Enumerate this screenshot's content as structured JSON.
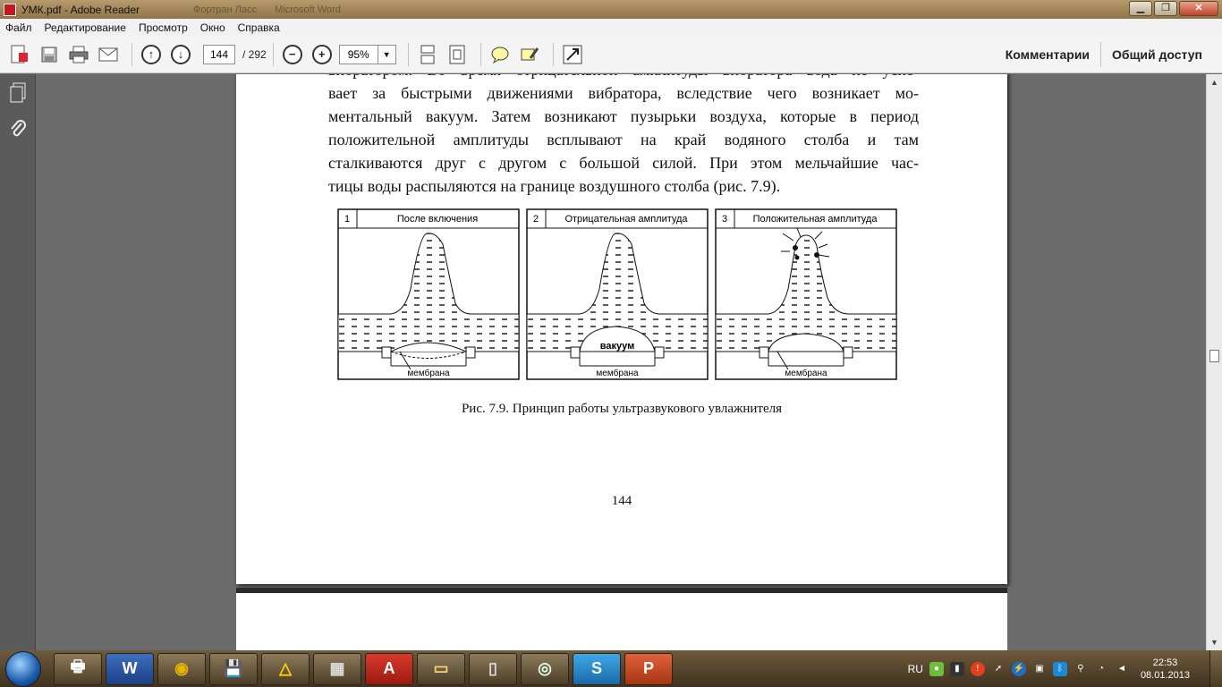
{
  "window": {
    "title": "УМК.pdf - Adobe Reader",
    "ghost_tabs": [
      "Фортран Ласс",
      "Microsoft Word"
    ],
    "buttons": {
      "minimize": "▁",
      "maximize": "❐",
      "close": "✕"
    }
  },
  "menu": [
    "Файл",
    "Редактирование",
    "Просмотр",
    "Окно",
    "Справка"
  ],
  "toolbar": {
    "page_current": "144",
    "page_total": "/ 292",
    "zoom": "95%",
    "comments_label": "Комментарии",
    "share_label": "Общий доступ"
  },
  "document": {
    "lines": [
      "вибратором. Во время отрицательной амплитуды вибратора вода не успе-",
      "вает за быстрыми движениями вибратора, вследствие чего возникает мо-",
      "ментальный вакуум. Затем возникают пузырьки воздуха, которые в период",
      "положительной амплитуды всплывают на край водяного столба и там",
      "сталкиваются друг с другом с большой силой. При этом мельчайшие час-",
      "тицы воды распыляются на границе воздушного столба (рис. 7.9)."
    ],
    "figure": {
      "panels": [
        {
          "num": "1",
          "title": "После включения",
          "label": "мембрана"
        },
        {
          "num": "2",
          "title": "Отрицательная амплитуда",
          "label": "мембрана",
          "extra": "вакуум"
        },
        {
          "num": "3",
          "title": "Положительная амплитуда",
          "label": "мембрана"
        }
      ]
    },
    "caption": "Рис. 7.9. Принцип работы ультразвукового увлажнителя",
    "page_number": "144"
  },
  "taskbar": {
    "apps": [
      "printer",
      "word",
      "chrome",
      "save",
      "app-triangle",
      "calculator",
      "adobe-reader",
      "folder",
      "phone",
      "disc",
      "skype",
      "powerpoint"
    ],
    "app_glyphs": [
      "🖶",
      "W",
      "◉",
      "💾",
      "△",
      "▦",
      "A",
      "▭",
      "▯",
      "◎",
      "S",
      "P"
    ],
    "lang": "RU",
    "time": "22:53",
    "date": "08.01.2013"
  }
}
